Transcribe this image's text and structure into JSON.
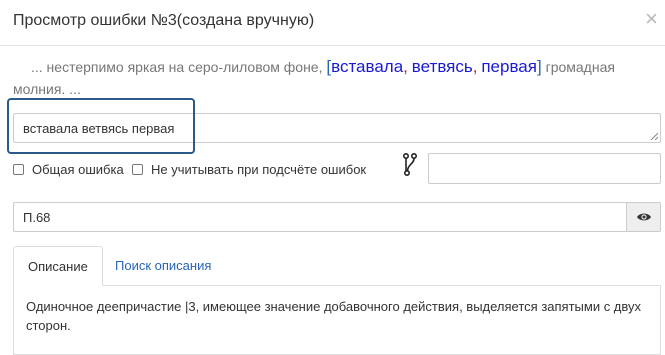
{
  "dialog": {
    "title": "Просмотр ошибки №3(создана вручную)",
    "close_label": "×"
  },
  "context": {
    "before": "... нестерпимо яркая на серо-лиловом фоне,",
    "open_bracket": "[",
    "word1": "вставала",
    "comma1": ",",
    "word2": "ветвясь",
    "comma2": ",",
    "word3": "первая",
    "close_bracket": "]",
    "after": "громадная молния. ..."
  },
  "answer": {
    "value": "вставала ветвясь первая"
  },
  "checkboxes": {
    "general_error": "Общая ошибка",
    "ignore_count": "Не учитывать при подсчёте ошибок"
  },
  "rule": {
    "value": "П.68"
  },
  "tabs": [
    {
      "label": "Описание"
    },
    {
      "label": "Поиск описания"
    }
  ],
  "description": {
    "text": "Одиночное деепричастие |3, имеющее значение добавочного действия, выделяется запятыми с двух сторон."
  },
  "colors": {
    "accent": "#2a64b7",
    "highlight_frame": "#2b5a8a",
    "comma": "#cc1f1f",
    "word": "#1a1ad6"
  }
}
